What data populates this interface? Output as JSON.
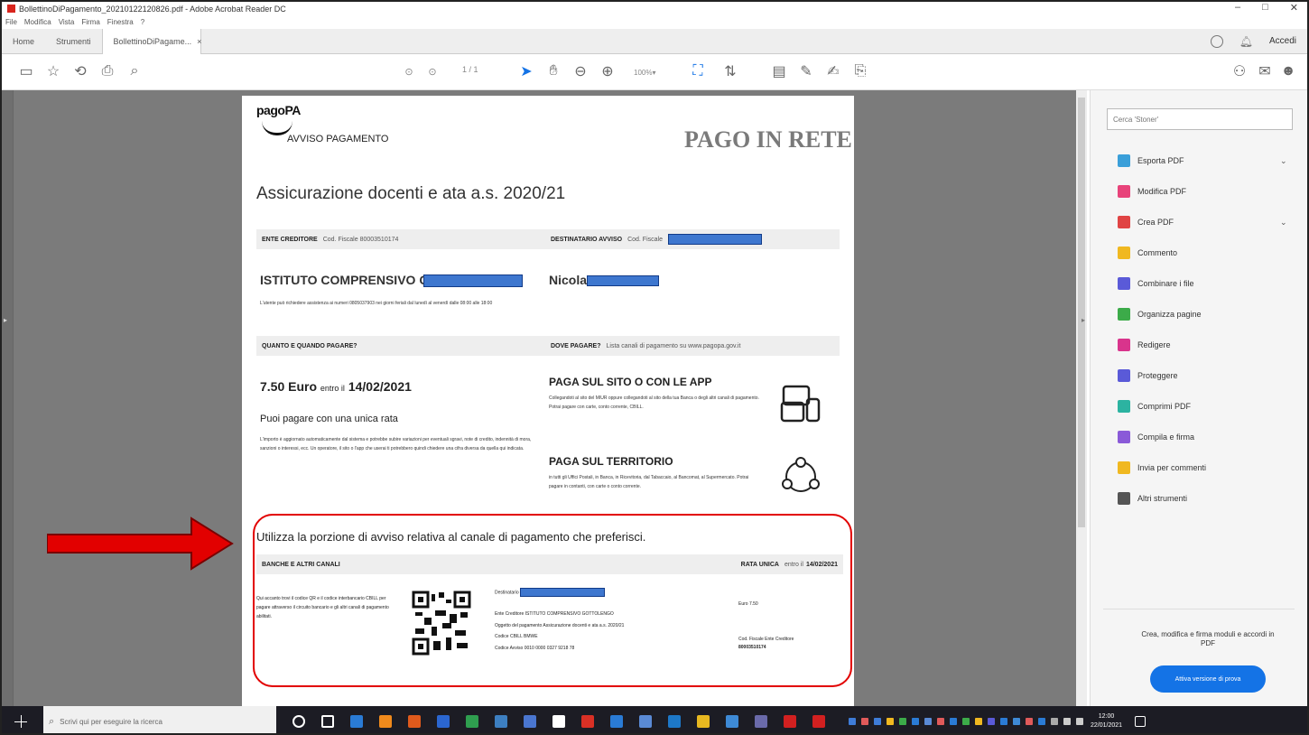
{
  "window": {
    "title": "BollettinoDiPagamento_20210122120826.pdf - Adobe Acrobat Reader DC",
    "controls": [
      "–",
      "□",
      "✕"
    ]
  },
  "menu": [
    "File",
    "Modifica",
    "Vista",
    "Firma",
    "Finestra",
    "?"
  ],
  "tabs": {
    "home": "Home",
    "tools": "Strumenti",
    "doc": "BollettinoDiPagame...",
    "close": "×",
    "signin": "Accedi"
  },
  "toolbar": {
    "page_indicator": "1 / 1",
    "zoom": "100%"
  },
  "document": {
    "brand": "pagoPA",
    "avviso": "AVVISO PAGAMENTO",
    "partner_logo": "PAGO IN RETE",
    "title": "Assicurazione docenti e ata a.s. 2020/21",
    "ente_header": "ENTE CREDITORE",
    "ente_cf": "Cod. Fiscale 80003510174",
    "dest_header": "DESTINATARIO AVVISO",
    "dest_cf": "Cod. Fiscale",
    "ente_name": "ISTITUTO COMPRENSIVO G",
    "ente_note": "L'utente può richiedere assistenza ai numeri 0805037903 nei giorni feriali dal lunedì al venerdì dalle 08:00 alle 18:00",
    "dest_name": "Nicola",
    "quanto_header": "QUANTO E QUANDO PAGARE?",
    "dove_header": "DOVE PAGARE?",
    "dove_text": "Lista canali di pagamento su www.pagopa.gov.it",
    "amount": "7.50 Euro",
    "entro": "entro il",
    "due_date": "14/02/2021",
    "unica": "Puoi pagare con una unica rata",
    "unica_note": "L'importo è aggiornato automaticamente dal sistema e potrebbe subire variazioni per eventuali sgravi, note di credito, indennità di mora, sanzioni o interessi, ecc. Un operatore, il sito o l'app che userai ti potrebbero quindi chiedere una cifra diversa da quella qui indicata.",
    "sito_title": "PAGA SUL SITO O CON LE APP",
    "sito_note": "Collegandoti al sito del MIUR oppure collegandoti al sito della tua Banca o degli altri canali di pagamento. Potrai pagare con carte, conto corrente, CBILL.",
    "terr_title": "PAGA SUL TERRITORIO",
    "terr_note": "in tutti gli Uffici Postali, in Banca, in Ricevitoria, dal Tabaccaio, al Bancomat, al Supermercato. Potrai pagare in contanti, con carte o conto corrente.",
    "utilizza": "Utilizza la porzione di avviso relativa al canale di pagamento che preferisci.",
    "banche_header": "BANCHE E ALTRI CANALI",
    "rata_header": "RATA UNICA",
    "rata_entro": "entro il",
    "rata_date": "14/02/2021",
    "banche_note": "Qui accanto trovi il codice QR e il codice interbancario CBILL per pagare attraverso il circuito bancario e gli altri canali di pagamento abilitati.",
    "dest_label": "Destinatario",
    "ente_line": "Ente Creditore ISTITUTO COMPRENSIVO GOTTOLENGO",
    "oggetto_line": "Oggetto del pagamento Assicurazione docenti e ata a.s. 2020/21",
    "cbill_line": "Codice CBILL BMWE",
    "avviso_line": "Codice Avviso 0010 0000 0327 9218 78",
    "euro_small": "Euro 7.50",
    "cf_ente_label": "Cod. Fiscale Ente Creditore",
    "cf_ente_value": "80003510174"
  },
  "tools": [
    {
      "label": "Esporta PDF",
      "icon": "export-pdf-icon",
      "color": "#3a9fd9",
      "chevron": true
    },
    {
      "label": "Modifica PDF",
      "icon": "edit-pdf-icon",
      "color": "#e8437a",
      "chevron": false
    },
    {
      "label": "Crea PDF",
      "icon": "create-pdf-icon",
      "color": "#e04444",
      "chevron": true
    },
    {
      "label": "Commento",
      "icon": "comment-icon",
      "color": "#f0b820",
      "chevron": false
    },
    {
      "label": "Combinare i file",
      "icon": "combine-icon",
      "color": "#5a5ad8",
      "chevron": false
    },
    {
      "label": "Organizza pagine",
      "icon": "organize-icon",
      "color": "#3cab49",
      "chevron": false
    },
    {
      "label": "Redigere",
      "icon": "redact-icon",
      "color": "#d9348c",
      "chevron": false
    },
    {
      "label": "Proteggere",
      "icon": "protect-icon",
      "color": "#5a5ad8",
      "chevron": false
    },
    {
      "label": "Comprimi PDF",
      "icon": "compress-icon",
      "color": "#2cb3a1",
      "chevron": false
    },
    {
      "label": "Compila e firma",
      "icon": "fill-sign-icon",
      "color": "#8a5ad8",
      "chevron": false
    },
    {
      "label": "Invia per commenti",
      "icon": "send-comments-icon",
      "color": "#f0b820",
      "chevron": false
    },
    {
      "label": "Altri strumenti",
      "icon": "more-tools-icon",
      "color": "#555555",
      "chevron": false
    }
  ],
  "tools_search_placeholder": "Cerca 'Stoner'",
  "promo": {
    "text": "Crea, modifica e firma moduli e accordi in PDF",
    "button": "Attiva versione di prova"
  },
  "taskbar": {
    "search_placeholder": "Scrivi qui per eseguire la ricerca",
    "time": "12:00",
    "date": "22/01/2021",
    "app_colors": [
      "#ffffff",
      "#ffffff",
      "#2a7bd5",
      "#f08a1c",
      "#e05a1c",
      "#2b66d0",
      "#2f9e4f",
      "#3d7fc1",
      "#4a76d0",
      "#ffffff",
      "#d93025",
      "#2a7bd5",
      "#5a8ad5",
      "#1d78c8",
      "#e8b820",
      "#3e8ad6",
      "#6a6aaa",
      "#d22020",
      "#d22020"
    ],
    "tray_colors": [
      "#3e7cd8",
      "#e05a5a",
      "#3e7cd8",
      "#f0b820",
      "#3cab49",
      "#2a7bd5",
      "#5a8ad5",
      "#e05a5a",
      "#2a7bd5",
      "#3cab49",
      "#f0b820",
      "#5a5ad8",
      "#2a7bd5",
      "#3e8ad6",
      "#e05a5a",
      "#2a7bd5",
      "#aaaaaa",
      "#cccccc",
      "#cccccc"
    ]
  }
}
